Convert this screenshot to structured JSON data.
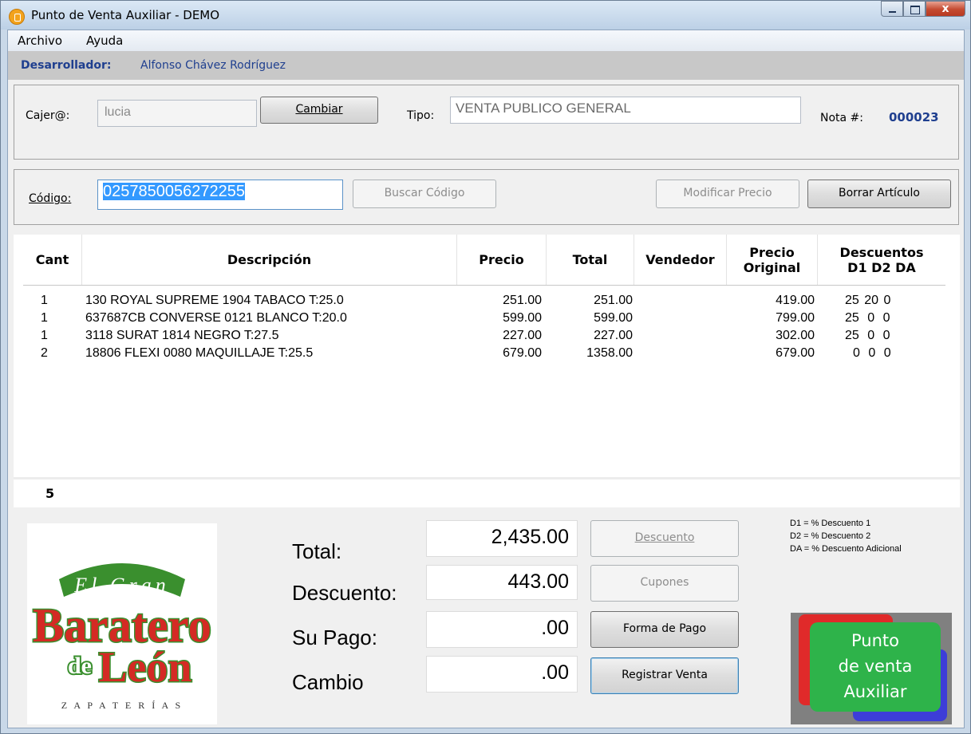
{
  "window": {
    "title": "Punto de Venta Auxiliar - DEMO",
    "close_glyph": "x"
  },
  "menu": {
    "archivo": "Archivo",
    "ayuda": "Ayuda"
  },
  "developer": {
    "label": "Desarrollador:",
    "name": "Alfonso Chávez Rodríguez"
  },
  "cashier": {
    "label": "Cajer@:",
    "value": "lucia",
    "change_button": "Cambiar"
  },
  "type": {
    "label": "Tipo:",
    "value": "VENTA PUBLICO GENERAL"
  },
  "note": {
    "label": "Nota #:",
    "value": "000023"
  },
  "code": {
    "label": "Código:",
    "value": "0257850056272255",
    "search_button": "Buscar Código",
    "modify_price_button": "Modificar Precio",
    "delete_item_button": "Borrar Artículo"
  },
  "table": {
    "headers": {
      "cant": "Cant",
      "descripcion": "Descripción",
      "precio": "Precio",
      "total": "Total",
      "vendedor": "Vendedor",
      "precio_original": "Precio Original",
      "descuentos": "Descuentos D1 D2 DA"
    },
    "rows": [
      {
        "cant": "1",
        "descripcion": "130 ROYAL SUPREME 1904 TABACO T:25.0",
        "precio": "251.00",
        "total": "251.00",
        "vendedor": "",
        "precio_original": "419.00",
        "descuentos": "25 20 0"
      },
      {
        "cant": "1",
        "descripcion": "637687CB CONVERSE 0121 BLANCO T:20.0",
        "precio": "599.00",
        "total": "599.00",
        "vendedor": "",
        "precio_original": "799.00",
        "descuentos": "25 0 0"
      },
      {
        "cant": "1",
        "descripcion": "3118 SURAT 1814 NEGRO T:27.5",
        "precio": "227.00",
        "total": "227.00",
        "vendedor": "",
        "precio_original": "302.00",
        "descuentos": "25 0 0"
      },
      {
        "cant": "2",
        "descripcion": "18806 FLEXI 0080 MAQUILLAJE T:25.5",
        "precio": "679.00",
        "total": "1358.00",
        "vendedor": "",
        "precio_original": "679.00",
        "descuentos": "0 0 0"
      }
    ],
    "item_count": "5"
  },
  "totals": {
    "total_label": "Total:",
    "total_value": "2,435.00",
    "discount_label": "Descuento:",
    "discount_value": "443.00",
    "payment_label": "Su Pago:",
    "payment_value": ".00",
    "change_label": "Cambio",
    "change_value": ".00"
  },
  "actions": {
    "discount": "Descuento",
    "coupons": "Cupones",
    "payment_method": "Forma de Pago",
    "register_sale": "Registrar Venta"
  },
  "legend": {
    "d1": "D1 = % Descuento 1",
    "d2": "D2 = % Descuento 2",
    "da": "DA = % Descuento Adicional"
  },
  "logo": {
    "line1": "El Gran",
    "line2": "Baratero",
    "line3": "de",
    "line4": "León",
    "line5": "Z A P A T E R Í A S"
  },
  "badge": {
    "line1": "Punto",
    "line2": "de venta",
    "line3": "Auxiliar"
  },
  "colors": {
    "accent_blue": "#1f3f8f",
    "logo_red": "#d42a24",
    "logo_green": "#3a8f2e",
    "badge_green": "#2eb34a"
  }
}
